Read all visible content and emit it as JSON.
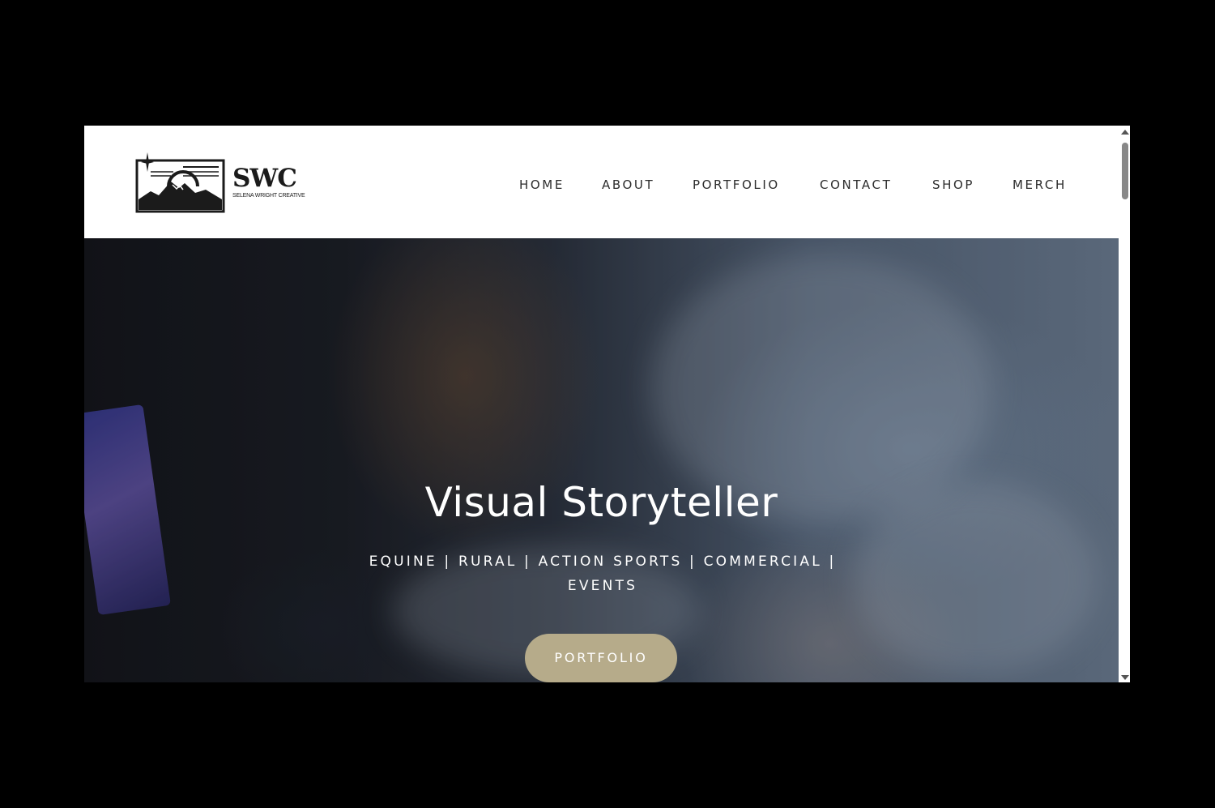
{
  "site": {
    "logo": {
      "wordmark": "SWC",
      "subtitle": "SELENA WRIGHT CREATIVE"
    },
    "nav": [
      {
        "label": "HOME"
      },
      {
        "label": "ABOUT"
      },
      {
        "label": "PORTFOLIO"
      },
      {
        "label": "CONTACT"
      },
      {
        "label": "SHOP"
      },
      {
        "label": "MERCH"
      }
    ]
  },
  "hero": {
    "title": "Visual Storyteller",
    "subtitle": "EQUINE | RURAL | ACTION SPORTS | COMMERCIAL | EVENTS",
    "cta_label": "PORTFOLIO",
    "cta_color": "#b6ab8a"
  },
  "icons": {
    "logo_mark": "mountain-emblem-icon",
    "scroll_up": "chevron-up-icon",
    "scroll_down": "chevron-down-icon"
  }
}
